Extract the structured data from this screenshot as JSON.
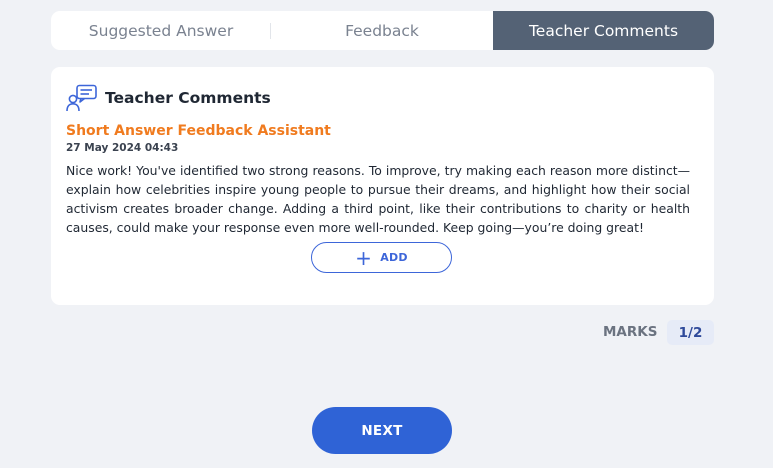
{
  "tabs": [
    {
      "label": "Suggested Answer",
      "active": false
    },
    {
      "label": "Feedback",
      "active": false
    },
    {
      "label": "Teacher Comments",
      "active": true
    }
  ],
  "card": {
    "icon": "chat-user-icon",
    "title": "Teacher Comments",
    "assistant_name": "Short Answer Feedback Assistant",
    "timestamp": "27 May 2024 04:43",
    "comment": "Nice work! You've identified two strong reasons. To improve, try making each reason more distinct—explain how celebrities inspire young people to pursue their dreams, and highlight how their social activism creates broader change. Adding a third point, like their contributions to charity or health causes, could make your response even more well-rounded. Keep going—you’re doing great!",
    "add_button": {
      "icon": "plus-icon",
      "label": "ADD"
    }
  },
  "marks": {
    "label": "MARKS",
    "value": "1/2"
  },
  "next_button": {
    "label": "NEXT"
  },
  "colors": {
    "active_tab": "#546275",
    "accent_orange": "#f07b1f",
    "primary_blue": "#2f63d6",
    "background": "#f0f2f6"
  }
}
